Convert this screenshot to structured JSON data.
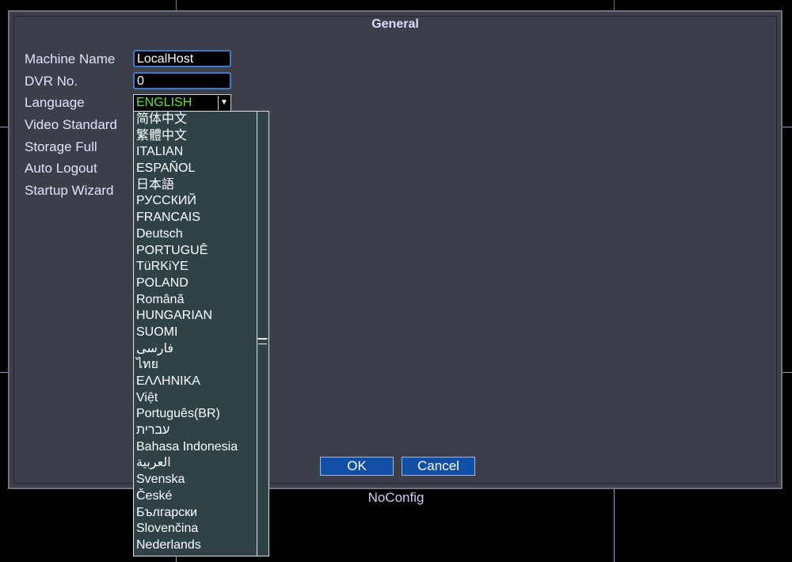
{
  "dialog": {
    "title": "General",
    "fields": {
      "machine_name": {
        "label": "Machine Name",
        "value": "LocalHost"
      },
      "dvr_no": {
        "label": "DVR No.",
        "value": "0"
      },
      "language": {
        "label": "Language",
        "value": "ENGLISH"
      },
      "video_standard": {
        "label": "Video Standard"
      },
      "storage_full": {
        "label": "Storage Full"
      },
      "auto_logout": {
        "label": "Auto Logout"
      },
      "startup_wizard": {
        "label": "Startup Wizard"
      }
    },
    "buttons": {
      "ok": "OK",
      "cancel": "Cancel"
    }
  },
  "status_text": "NoConfig",
  "language_dropdown": {
    "options": [
      "简体中文",
      "繁體中文",
      "ITALIAN",
      "ESPAÑOL",
      "日本語",
      "РУССКИЙ",
      "FRANCAIS",
      "Deutsch",
      "PORTUGUÊ",
      "TüRKiYE",
      "POLAND",
      "Română",
      "HUNGARIAN",
      "SUOMI",
      "فارسی",
      "ไทย",
      "ΕΛΛΗΝΙΚΑ",
      "Việt",
      "Português(BR)",
      "עברית",
      "Bahasa Indonesia",
      "العربية",
      "Svenska",
      "České",
      "Български",
      "Slovenčina",
      "Nederlands"
    ]
  },
  "icons": {
    "dropdown_arrow": "caret-down-icon"
  },
  "colors": {
    "accent": "#0f4fa8",
    "selected_text": "#66e033",
    "panel": "#3c3f4a"
  }
}
